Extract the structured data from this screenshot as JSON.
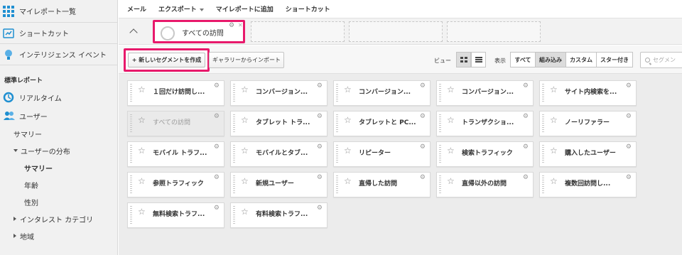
{
  "sidebar": {
    "top_items": [
      {
        "label": "マイレポート一覧",
        "icon": "grid-icon"
      },
      {
        "label": "ショートカット",
        "icon": "shortcut-icon"
      },
      {
        "label": "インテリジェンス イベント",
        "icon": "lightbulb-icon"
      }
    ],
    "section": "標準レポート",
    "realtime": "リアルタイム",
    "users": "ユーザー",
    "summary": "サマリー",
    "distribution": "ユーザーの分布",
    "dist_summary": "サマリー",
    "age": "年齢",
    "gender": "性別",
    "interest": "インタレスト カテゴリ",
    "region": "地域"
  },
  "topbar": {
    "mail": "メール",
    "export": "エクスポート",
    "add_myreport": "マイレポートに追加",
    "shortcut": "ショートカット"
  },
  "segbar": {
    "active_segment": "すべての訪問"
  },
  "toolbar": {
    "new_segment": "+ 新しいセグメントを作成",
    "import": "ギャラリーからインポート",
    "view_label": "ビュー",
    "show_label": "表示",
    "filters": [
      "すべて",
      "組み込み",
      "カスタム",
      "スター付き"
    ],
    "selected_filter": "組み込み",
    "search_placeholder": "セグメン"
  },
  "segments": [
    [
      "１回だけ訪問し...",
      "コンバージョン...",
      "コンバージョン...",
      "コンバージョン...",
      "サイト内検索を..."
    ],
    [
      "すべての訪問",
      "タブレット トラ...",
      "タブレットと PC...",
      "トランザクショ...",
      "ノーリファラー"
    ],
    [
      "モバイル トラフ...",
      "モバイルとタブ...",
      "リピーター",
      "検索トラフィック",
      "購入したユーザー"
    ],
    [
      "参照トラフィック",
      "新規ユーザー",
      "直帰した訪問",
      "直帰以外の訪問",
      "複数回訪問し..."
    ],
    [
      "無料検索トラフ...",
      "有料検索トラフ..."
    ]
  ],
  "colors": {
    "highlight": "#e8196b",
    "accent": "#1f8fd1"
  }
}
